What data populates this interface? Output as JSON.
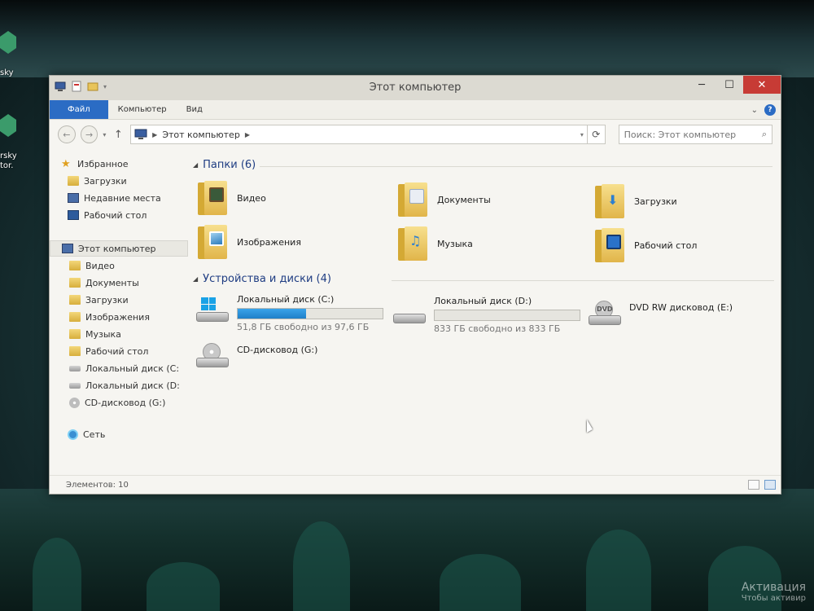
{
  "desktop": {
    "icons": [
      {
        "label_lines": [
          "sky"
        ]
      },
      {
        "label_lines": [
          "rsky",
          "tor."
        ]
      }
    ],
    "activation": {
      "line1": "Активация",
      "line2": "Чтобы активир"
    }
  },
  "window": {
    "title": "Этот компьютер",
    "ribbon_tabs": [
      "Файл",
      "Компьютер",
      "Вид"
    ],
    "address": {
      "path": "Этот компьютер"
    },
    "search": {
      "placeholder": "Поиск: Этот компьютер"
    },
    "nav": {
      "favorites": {
        "label": "Избранное",
        "items": [
          "Загрузки",
          "Недавние места",
          "Рабочий стол"
        ]
      },
      "computer": {
        "label": "Этот компьютер",
        "items": [
          "Видео",
          "Документы",
          "Загрузки",
          "Изображения",
          "Музыка",
          "Рабочий стол",
          "Локальный диск (C:",
          "Локальный диск (D:",
          "CD-дисковод (G:)"
        ]
      },
      "network": {
        "label": "Сеть"
      }
    },
    "folders": {
      "header": "Папки (6)",
      "items": [
        {
          "label": "Видео",
          "icon": "video-folder-icon"
        },
        {
          "label": "Документы",
          "icon": "documents-folder-icon"
        },
        {
          "label": "Загрузки",
          "icon": "downloads-folder-icon"
        },
        {
          "label": "Изображения",
          "icon": "pictures-folder-icon"
        },
        {
          "label": "Музыка",
          "icon": "music-folder-icon"
        },
        {
          "label": "Рабочий стол",
          "icon": "desktop-folder-icon"
        }
      ]
    },
    "devices": {
      "header": "Устройства и диски (4)",
      "drives": [
        {
          "name": "Локальный диск (C:)",
          "free": "51,8 ГБ свободно из 97,6 ГБ",
          "used_fraction": 0.47
        },
        {
          "name": "Локальный диск (D:)",
          "free": "833 ГБ свободно из 833 ГБ",
          "used_fraction": 0.0
        },
        {
          "name": "DVD RW дисковод (E:)",
          "dvd_label": "DVD"
        },
        {
          "name": "CD-дисковод (G:)"
        }
      ]
    },
    "status": {
      "count": "Элементов: 10"
    },
    "colors": {
      "accent": "#2b6cc4",
      "close": "#c73b35",
      "bar": "#1f7fc8",
      "heading": "#1e3c82"
    }
  }
}
